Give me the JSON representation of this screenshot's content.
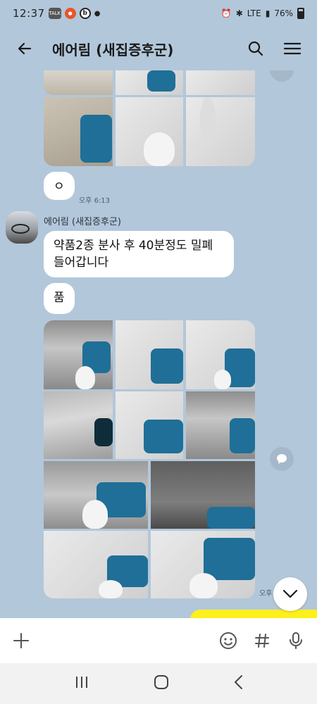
{
  "status_bar": {
    "time": "12:37",
    "network": "LTE",
    "battery": "76%"
  },
  "header": {
    "title": "에어림 (새집증후군)"
  },
  "messages": {
    "dot_message": "ㅇ",
    "dot_time": "오후 6:13",
    "sender_name": "에어림 (새집증후군)",
    "text_1": "약품2종 분사 후 40분정도 밀폐 들어갑니다",
    "text_2": "품",
    "photos_time": "오후"
  },
  "input_bar": {
    "placeholder": ""
  },
  "colors": {
    "chat_background": "#b2c7da",
    "my_bubble": "#fef01b",
    "other_bubble": "#ffffff"
  }
}
